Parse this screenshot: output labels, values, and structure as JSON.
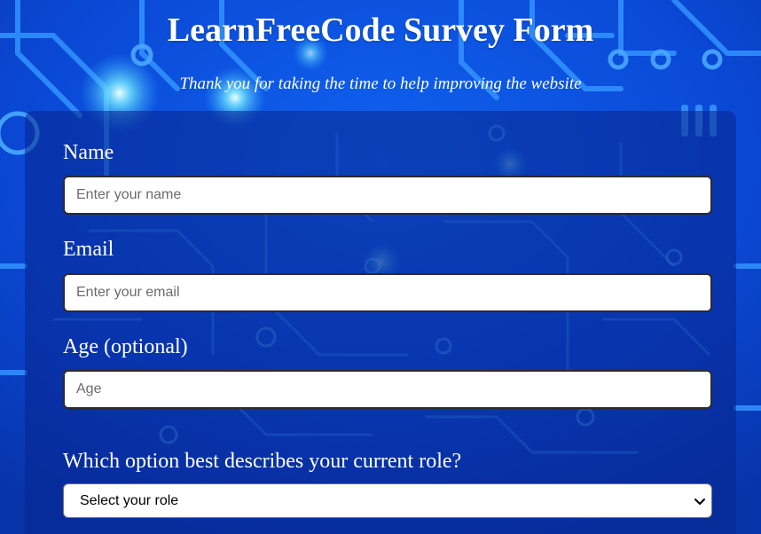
{
  "header": {
    "title": "LearnFreeCode Survey Form",
    "subtitle": "Thank you for taking the time to help improving the website"
  },
  "form": {
    "name": {
      "label": "Name",
      "placeholder": "Enter your name",
      "value": ""
    },
    "email": {
      "label": "Email",
      "placeholder": "Enter your email",
      "value": ""
    },
    "age": {
      "label": "Age (optional)",
      "placeholder": "Age",
      "value": ""
    },
    "role": {
      "label": "Which option best describes your current role?",
      "selected": "Select your role"
    }
  },
  "colors": {
    "background": "#0a49d6",
    "panel": "#08248c",
    "circuit_trace": "#2f8dff",
    "glow": "#7fe8ff",
    "text": "#ffffff"
  }
}
